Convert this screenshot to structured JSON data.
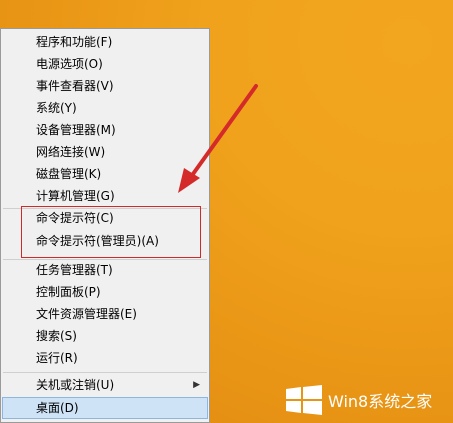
{
  "menu": {
    "items": [
      {
        "label": "程序和功能(F)"
      },
      {
        "label": "电源选项(O)"
      },
      {
        "label": "事件查看器(V)"
      },
      {
        "label": "系统(Y)"
      },
      {
        "label": "设备管理器(M)"
      },
      {
        "label": "网络连接(W)"
      },
      {
        "label": "磁盘管理(K)"
      },
      {
        "label": "计算机管理(G)"
      },
      {
        "label": "命令提示符(C)"
      },
      {
        "label": "命令提示符(管理员)(A)"
      },
      {
        "label": "任务管理器(T)"
      },
      {
        "label": "控制面板(P)"
      },
      {
        "label": "文件资源管理器(E)"
      },
      {
        "label": "搜索(S)"
      },
      {
        "label": "运行(R)"
      },
      {
        "label": "关机或注销(U)"
      },
      {
        "label": "桌面(D)"
      }
    ]
  },
  "watermark": {
    "text": "Win8系统之家",
    "icon": "windows-logo-icon"
  },
  "colors": {
    "annotation": "#cf2a2a",
    "background": "#f0a21c",
    "selected": "#cfe3f7"
  }
}
